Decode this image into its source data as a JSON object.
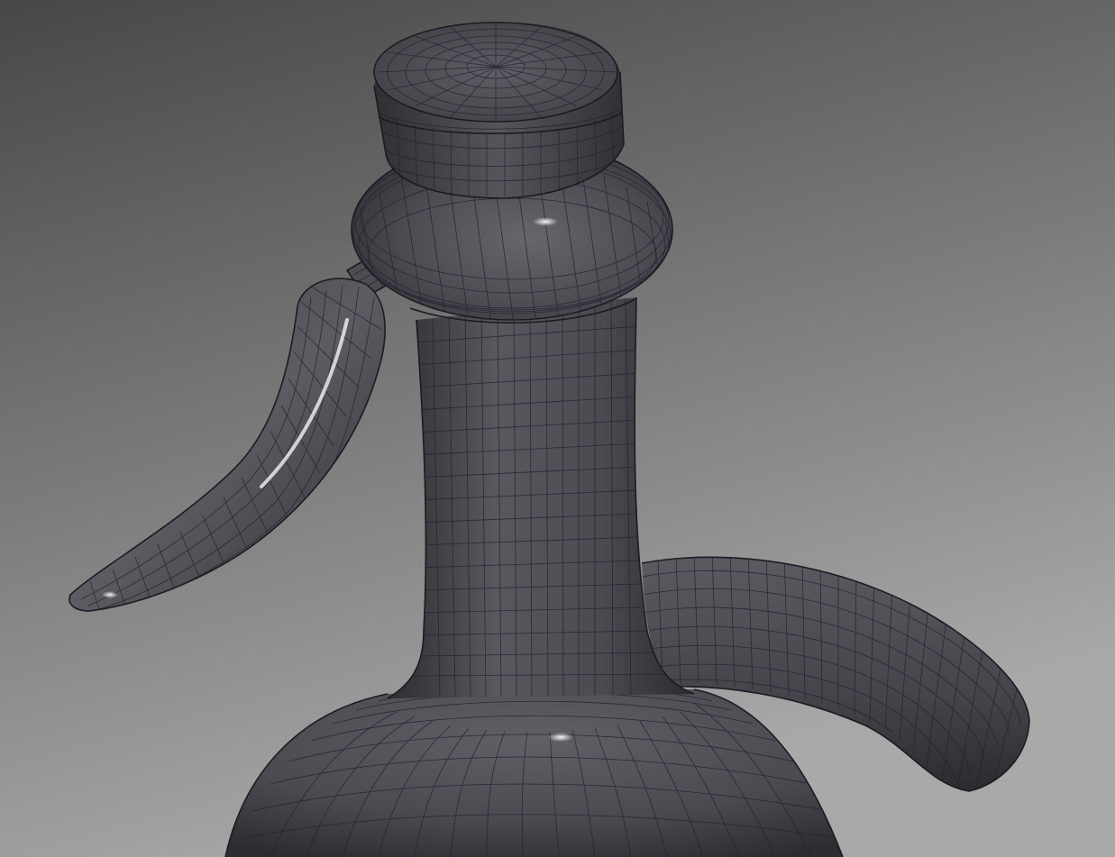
{
  "viewport": {
    "background_top": "#4a4a4a",
    "background_bottom": "#a8a8a8",
    "mesh_fill": "#4b4b4f",
    "mesh_fill_dark": "#2e2e33",
    "mesh_fill_light": "#6a6a70",
    "wire_color": "#2a2030"
  },
  "model": {
    "parts": [
      "cap",
      "collar",
      "neck",
      "lever",
      "spout",
      "bottle-body"
    ]
  }
}
